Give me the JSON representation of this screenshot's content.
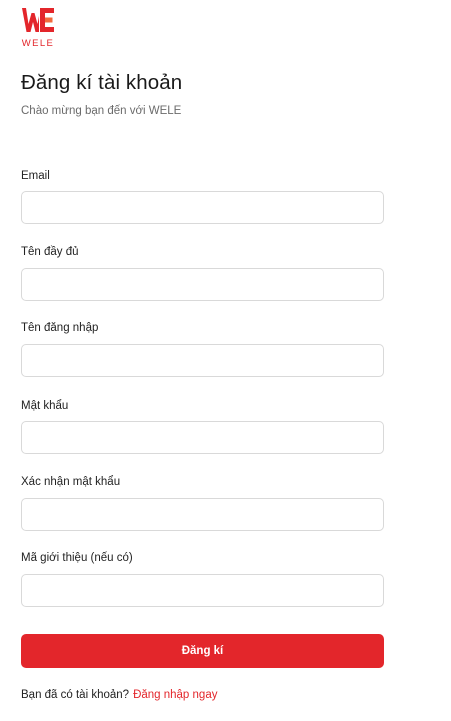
{
  "brand": {
    "name": "WELE",
    "accent_color": "#e3262b"
  },
  "header": {
    "title": "Đăng kí tài khoản",
    "subtitle": "Chào mừng bạn đến với WELE"
  },
  "form": {
    "fields": [
      {
        "label": "Email",
        "value": "",
        "placeholder": ""
      },
      {
        "label": "Tên đầy đủ",
        "value": "",
        "placeholder": ""
      },
      {
        "label": "Tên đăng nhập",
        "value": "",
        "placeholder": ""
      },
      {
        "label": "Mật khẩu",
        "value": "",
        "placeholder": ""
      },
      {
        "label": "Xác nhận mật khẩu",
        "value": "",
        "placeholder": ""
      },
      {
        "label": "Mã giới thiệu (nếu có)",
        "value": "",
        "placeholder": ""
      }
    ],
    "submit_label": "Đăng kí"
  },
  "footer": {
    "prompt": "Bạn đã có tài khoản?",
    "login_link": "Đăng nhập ngay"
  }
}
